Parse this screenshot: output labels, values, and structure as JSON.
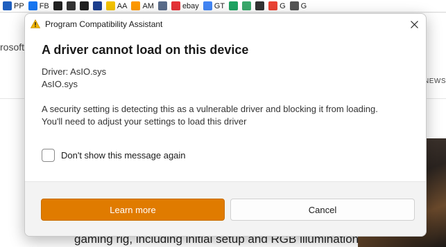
{
  "bookmarks": [
    {
      "label": "PP",
      "icon": "paypal-icon",
      "color": "#1f5fbf"
    },
    {
      "label": "FB",
      "icon": "facebook-icon",
      "color": "#1877f2"
    },
    {
      "label": "",
      "icon": "bookmark-icon-1",
      "color": "#222222"
    },
    {
      "label": "",
      "icon": "bookmark-icon-2",
      "color": "#333333"
    },
    {
      "label": "",
      "icon": "bookmark-icon-3",
      "color": "#222222"
    },
    {
      "label": "",
      "icon": "usa-icon",
      "color": "#1d3f8f"
    },
    {
      "label": "AA",
      "icon": "aa-icon",
      "color": "#f2c200"
    },
    {
      "label": "AM",
      "icon": "amazon-icon",
      "color": "#ff9900"
    },
    {
      "label": "",
      "icon": "seal-icon",
      "color": "#5a6c8a"
    },
    {
      "label": "ebay",
      "icon": "ebay-icon",
      "color": "#e53238"
    },
    {
      "label": "GT",
      "icon": "translate-icon",
      "color": "#4285f4"
    },
    {
      "label": "",
      "icon": "green-circle-icon",
      "color": "#1ea362"
    },
    {
      "label": "",
      "icon": "wave-icon",
      "color": "#3aa86b"
    },
    {
      "label": "",
      "icon": "history-icon",
      "color": "#333333"
    },
    {
      "label": "G",
      "icon": "google-icon",
      "color": "#ea4335"
    },
    {
      "label": "G",
      "icon": "globe-icon",
      "color": "#555555"
    }
  ],
  "background": {
    "brand": "rosoft",
    "news": "NEWS",
    "headline": "gaming rig, including initial setup and RGB illumination"
  },
  "dialog": {
    "title": "Program Compatibility Assistant",
    "heading": "A driver cannot load on this device",
    "driver_line": "Driver: AsIO.sys",
    "file_line": "AsIO.sys",
    "message_line1": "A security setting is detecting this as a vulnerable driver and blocking it from loading.",
    "message_line2": "You'll need to adjust your settings to load this driver",
    "checkbox_label": "Don't show this message again",
    "checkbox_checked": false,
    "learn_more_label": "Learn more",
    "cancel_label": "Cancel",
    "accent_color": "#e07b00",
    "warning_color": "#f0b400"
  }
}
